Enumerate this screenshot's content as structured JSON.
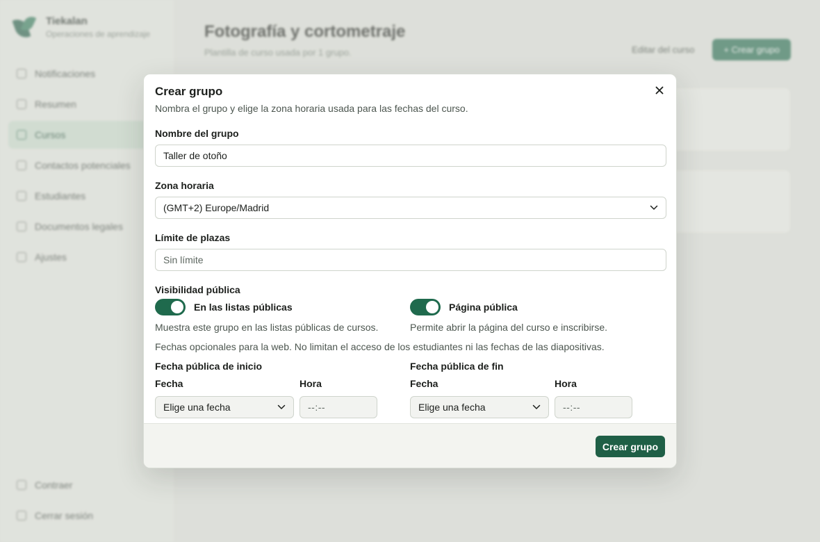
{
  "background": {
    "brand": {
      "name": "Tiekalan",
      "subtitle": "Operaciones de aprendizaje"
    },
    "nav": [
      {
        "label": "Notificaciones",
        "active": false
      },
      {
        "label": "Resumen",
        "active": false
      },
      {
        "label": "Cursos",
        "active": true
      },
      {
        "label": "Contactos potenciales",
        "active": false
      },
      {
        "label": "Estudiantes",
        "active": false
      },
      {
        "label": "Documentos legales",
        "active": false
      },
      {
        "label": "Ajustes",
        "active": false
      }
    ],
    "nav_bottom": [
      {
        "label": "Contraer"
      },
      {
        "label": "Cerrar sesión"
      }
    ],
    "page": {
      "title": "Fotografía y cortometraje",
      "subtitle": "Plantilla de curso usada por 1 grupo.",
      "edit_label": "Editar del curso",
      "create_label": "+ Crear grupo"
    }
  },
  "modal": {
    "title": "Crear grupo",
    "description": "Nombra el grupo y elige la zona horaria usada para las fechas del curso.",
    "name": {
      "label": "Nombre del grupo",
      "value": "Taller de otoño"
    },
    "timezone": {
      "label": "Zona horaria",
      "value": "(GMT+2) Europe/Madrid"
    },
    "limit": {
      "label": "Límite de plazas",
      "placeholder": "Sin límite"
    },
    "visibility": {
      "label": "Visibilidad pública",
      "listing": {
        "label": "En las listas públicas",
        "help": "Muestra este grupo en las listas públicas de cursos.",
        "on": true
      },
      "page": {
        "label": "Página pública",
        "help": "Permite abrir la página del curso e inscribirse.",
        "on": true
      }
    },
    "dates_note": "Fechas opcionales para la web. No limitan el acceso de los estudiantes ni las fechas de las diapositivas.",
    "start": {
      "title": "Fecha pública de inicio",
      "date_label": "Fecha",
      "date_placeholder": "Elige una fecha",
      "time_label": "Hora",
      "time_placeholder": "--:--"
    },
    "end": {
      "title": "Fecha pública de fin",
      "date_label": "Fecha",
      "date_placeholder": "Elige una fecha",
      "time_label": "Hora",
      "time_placeholder": "--:--"
    },
    "submit_label": "Crear grupo"
  },
  "colors": {
    "accent": "#1f6a4d",
    "primary_button": "#1f5f46"
  }
}
